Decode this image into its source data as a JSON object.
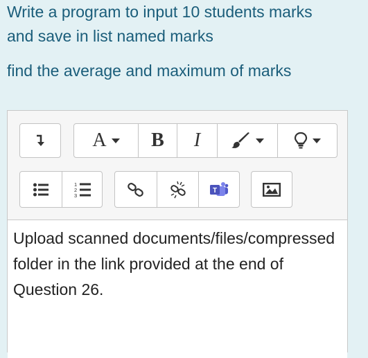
{
  "question": {
    "line1": "Write a program to input 10 students marks",
    "line2": "and save in list named marks",
    "line3": "find the average and maximum of marks"
  },
  "toolbar": {
    "row1": {
      "toggle_icon": "collapse-toolbar-icon",
      "font_label": "A",
      "bold_label": "B",
      "italic_label": "I",
      "brush_icon": "paint-brush-icon",
      "lightbulb_icon": "lightbulb-icon"
    },
    "row2": {
      "unordered_list_icon": "bullet-list-icon",
      "ordered_list_icon": "numbered-list-icon",
      "ordered_list_numbers": [
        "1",
        "2",
        "3"
      ],
      "link_icon": "link-icon",
      "unlink_icon": "unlink-icon",
      "teams_icon": "teams-icon",
      "teams_letter": "T",
      "image_icon": "image-icon"
    }
  },
  "editor": {
    "content": "Upload scanned documents/files/compressed folder in the link provided at the end of Question 26."
  },
  "colors": {
    "page_background": "#e3f1f4",
    "question_text": "#1a5d7a",
    "teams_purple": "#5059c9",
    "toolbar_background": "#f6f6f6"
  }
}
